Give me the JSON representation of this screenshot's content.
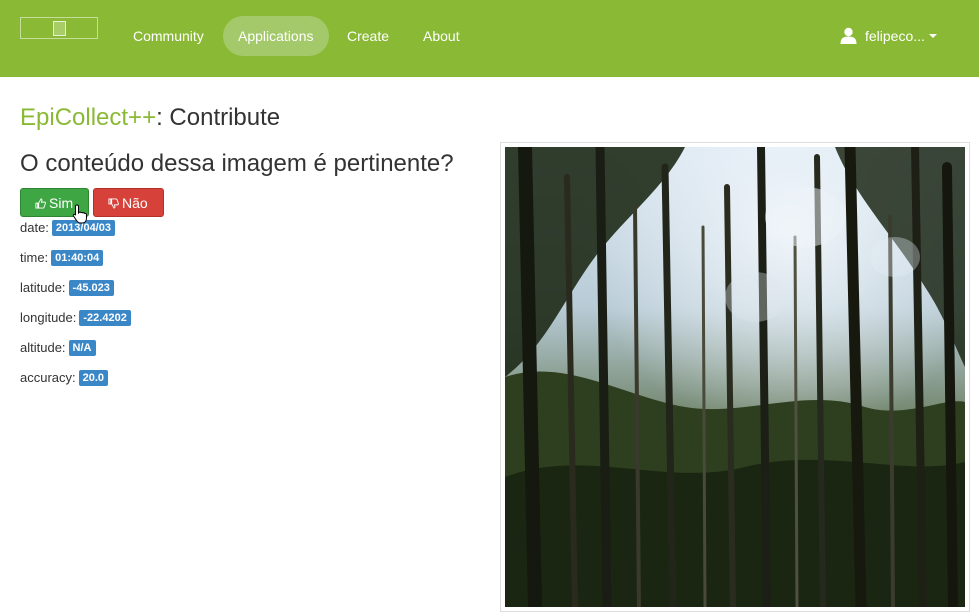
{
  "nav": {
    "logo": "broken-image-icon",
    "items": [
      {
        "label": "Community",
        "active": false
      },
      {
        "label": "Applications",
        "active": true
      },
      {
        "label": "Create",
        "active": false
      },
      {
        "label": "About",
        "active": false
      }
    ],
    "user": {
      "icon": "user-icon",
      "name": "felipeco..."
    }
  },
  "page": {
    "app_name": "EpiCollect++",
    "title_suffix": ": Contribute",
    "question": "O conteúdo dessa imagem é pertinente?"
  },
  "actions": {
    "yes_label": "Sim",
    "yes_icon": "thumbs-up-icon",
    "no_label": "Não",
    "no_icon": "thumbs-down-icon"
  },
  "metadata": [
    {
      "key": "date:",
      "value": "2013/04/03"
    },
    {
      "key": "time:",
      "value": "01:40:04"
    },
    {
      "key": "latitude:",
      "value": "-45.023"
    },
    {
      "key": "longitude:",
      "value": "-22.4202"
    },
    {
      "key": "altitude:",
      "value": "N/A"
    },
    {
      "key": "accuracy:",
      "value": "20.0"
    }
  ],
  "colors": {
    "brand": "#8aba35",
    "success": "#3ea643",
    "danger": "#d6423a",
    "info": "#3a87c8"
  },
  "photo": {
    "subject": "forest-photo"
  }
}
